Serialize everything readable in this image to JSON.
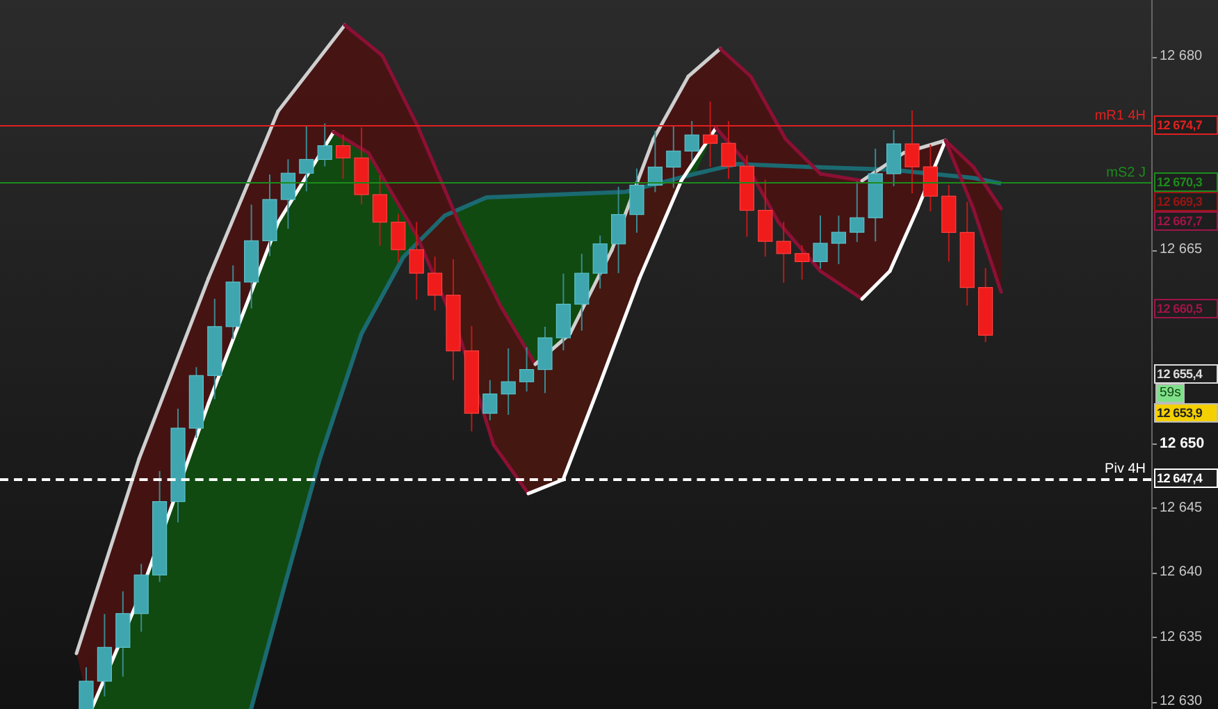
{
  "axis": {
    "ticks": [
      {
        "label": "12 680",
        "bold": false
      },
      {
        "label": "12 665",
        "bold": false
      },
      {
        "label": "12 650",
        "bold": true
      },
      {
        "label": "12 645",
        "bold": false
      },
      {
        "label": "12 640",
        "bold": false
      },
      {
        "label": "12 635",
        "bold": false
      },
      {
        "label": "12 630",
        "bold": false
      }
    ]
  },
  "levels": [
    {
      "name": "mR1 4H",
      "tag": "12 674,7",
      "color": "#e02020",
      "kind": "solid"
    },
    {
      "name": "mS2 J",
      "tag": "12 670,3",
      "color": "#1c8c1c",
      "kind": "solid"
    },
    {
      "name": "Piv 4H",
      "tag": "12 647,4",
      "color": "#ffffff",
      "kind": "dashed"
    }
  ],
  "indicator_tags": [
    {
      "tag": "12 669,3",
      "color": "#9a1414"
    },
    {
      "tag": "12 667,7",
      "color": "#a0144a"
    },
    {
      "tag": "12 660,5",
      "color": "#a0144a"
    },
    {
      "tag": "12 655,4",
      "color": "#dddddd"
    }
  ],
  "price": {
    "tag": "12 653,9",
    "countdown": "59s"
  }
}
